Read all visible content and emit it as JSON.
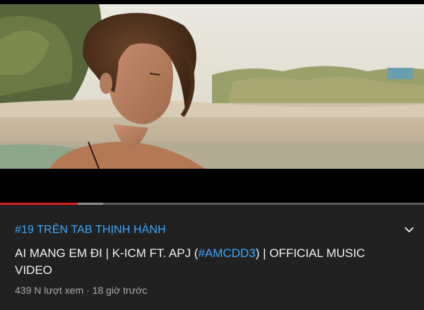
{
  "player": {
    "progress_played_fraction": 0.183,
    "progress_buffered_fraction": 0.243
  },
  "video": {
    "trending_tag": "#19 TRÊN TAB THỊNH HÀNH",
    "title_before": "AI MANG EM ĐI | K-ICM FT. APJ (",
    "title_hashtag": "#AMCDD3",
    "title_after": ") | OFFICIAL MUSIC VIDEO",
    "views": "439 N lượt xem",
    "separator": "·",
    "published": "18 giờ trước"
  },
  "icons": {
    "expand": "chevron-down-icon"
  },
  "colors": {
    "background": "#212121",
    "link": "#3ea6ff",
    "progress_played": "#d71e1e",
    "progress_buffered": "#8e8e8e"
  }
}
